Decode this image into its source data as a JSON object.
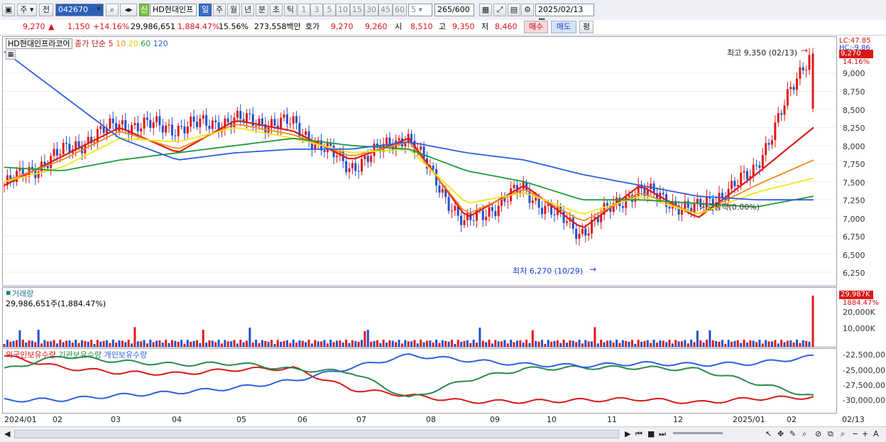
{
  "toolbar": {
    "period_type": "주",
    "prev_label": "전",
    "code": "042670",
    "name": "HD현대인프",
    "new_label": "신",
    "period_tabs": [
      "일",
      "주",
      "월",
      "년",
      "분",
      "초",
      "틱"
    ],
    "active_tab": "일",
    "num_tabs": [
      "1",
      "3",
      "5",
      "10",
      "15",
      "30",
      "45",
      "60"
    ],
    "count_select": "5",
    "range": "265",
    "range_total": "/600",
    "date": "2025/02/13"
  },
  "quote": {
    "price": "9,270",
    "change": "1,150",
    "change_pct": "+14.16%",
    "volume": "29,986,651",
    "volume_pct": "1,884.47%",
    "turnover": "15.56%",
    "amount": "273,558백만",
    "hoga_label": "호가",
    "ask": "9,270",
    "bid": "9,260",
    "open_label": "시",
    "open": "8,510",
    "high_label": "고",
    "high": "9,350",
    "low_label": "저",
    "low": "8,460",
    "buy_label": "매수",
    "sell_label": "매도",
    "eval_label": "평"
  },
  "price_panel": {
    "title": "HD현대인프라코어",
    "legend_prefix": "종가 단순",
    "ma_periods": [
      "5",
      "10",
      "20",
      "60",
      "120"
    ],
    "ma_colors": [
      "#e01818",
      "#f08a1a",
      "#f5e31a",
      "#1e9a3a",
      "#2f5fe0"
    ],
    "lc_label": "LC:47.85",
    "hc_label": "HC:-9.86",
    "last_price_tag": "9,270",
    "last_pct_tag": "14.16%",
    "max_label": "최고 9,350 (02/13)",
    "min_label": "최저 6,270 (10/29)",
    "ref_label": "기준등락(0.00%)",
    "y_ticks": [
      "9,000",
      "8,750",
      "8,500",
      "8,250",
      "8,000",
      "7,750",
      "7,500",
      "7,250",
      "7,000",
      "6,750",
      "6,500",
      "6,250"
    ]
  },
  "volume_panel": {
    "title": "거래량",
    "value_text": "29,986,651주(1,884.47%)",
    "tag_value": "29,987K",
    "tag_pct": "1884.47%",
    "y_ticks": [
      "20,000K",
      "10,000K"
    ]
  },
  "holdings_panel": {
    "series_labels": [
      "외국인보유수량",
      "기관보유수량",
      "개인보유수량"
    ],
    "colors": [
      "#d81818",
      "#2a8a4a",
      "#2f5fe0"
    ],
    "y_ticks": [
      "-22,500,00",
      "-25,000,00",
      "-27,500,00",
      "-30,000,00"
    ]
  },
  "x_axis": {
    "labels": [
      "2024/01",
      "02",
      "03",
      "04",
      "05",
      "06",
      "07",
      "08",
      "09",
      "10",
      "11",
      "12",
      "2025/01",
      "02"
    ],
    "right_label": "02/13"
  },
  "chart_data": {
    "type": "candlestick",
    "title": "HD현대인프라코어",
    "x_range": [
      "2024/01",
      "2025/02/13"
    ],
    "ylim": [
      6250,
      9350
    ],
    "last_close": 9270,
    "period_high": {
      "value": 9350,
      "date": "02/13"
    },
    "period_low": {
      "value": 6270,
      "date": "10/29"
    },
    "close_series": {
      "x": [
        "2024/01",
        "02",
        "03",
        "04",
        "05",
        "06",
        "07",
        "08",
        "09",
        "10",
        "11",
        "12",
        "2025/01",
        "02",
        "02/13"
      ],
      "values": [
        7450,
        7900,
        8300,
        8250,
        8350,
        8300,
        7700,
        8150,
        6900,
        7400,
        6800,
        7400,
        7100,
        7600,
        9270
      ]
    },
    "ma_series": [
      {
        "name": "5",
        "values": [
          7450,
          7850,
          8250,
          7900,
          8350,
          8200,
          7800,
          8100,
          7000,
          7450,
          6850,
          7450,
          7000,
          7600,
          8250
        ]
      },
      {
        "name": "10",
        "values": [
          7500,
          7800,
          8200,
          7950,
          8300,
          8150,
          7850,
          8050,
          7050,
          7400,
          6950,
          7350,
          7050,
          7450,
          7800
        ]
      },
      {
        "name": "20",
        "values": [
          7500,
          7700,
          8100,
          8050,
          8250,
          8100,
          7900,
          7950,
          7200,
          7350,
          7050,
          7300,
          7050,
          7350,
          7550
        ]
      },
      {
        "name": "60",
        "values": [
          7700,
          7650,
          7800,
          7900,
          8000,
          8100,
          8000,
          7950,
          7650,
          7500,
          7250,
          7250,
          7200,
          7150,
          7300
        ]
      },
      {
        "name": "120",
        "values": [
          9300,
          8700,
          8100,
          7800,
          7900,
          7950,
          7950,
          8050,
          7900,
          7800,
          7600,
          7450,
          7300,
          7250,
          7250
        ]
      }
    ],
    "volume": {
      "last": 29986651,
      "unit": "주"
    },
    "holdings": [
      {
        "name": "외국인보유수량",
        "values": [
          -22600000,
          -24500000,
          -25300000,
          -25500000,
          -24800000,
          -24600000,
          -28000000,
          -29000000,
          -30000000,
          -30000000,
          -29800000,
          -29600000,
          -30200000,
          -29500000,
          -29300000
        ]
      },
      {
        "name": "기관보유수량",
        "values": [
          -24800000,
          -22600000,
          -23500000,
          -24000000,
          -23800000,
          -24800000,
          -25200000,
          -29500000,
          -26500000,
          -24700000,
          -24500000,
          -24500000,
          -24800000,
          -27000000,
          -29200000
        ]
      },
      {
        "name": "개인보유수량",
        "values": [
          -29800000,
          -29700000,
          -29000000,
          -28500000,
          -27800000,
          -26600000,
          -24500000,
          -22500000,
          -23300000,
          -24000000,
          -24200000,
          -23800000,
          -24000000,
          -23800000,
          -22700000
        ]
      }
    ]
  }
}
